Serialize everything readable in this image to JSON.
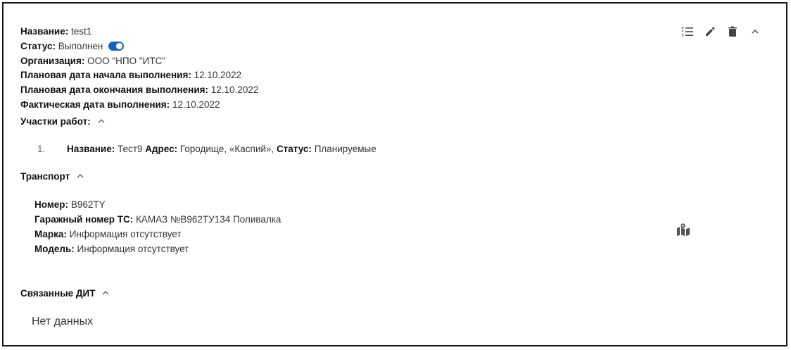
{
  "record": {
    "name_label": "Название:",
    "name_value": "test1",
    "status_label": "Статус:",
    "status_value": "Выполнен",
    "status_toggle_on": true,
    "org_label": "Организация:",
    "org_value": "ООО \"НПО \"ИТС\"",
    "plan_start_label": "Плановая дата начала выполнения:",
    "plan_start_value": "12.10.2022",
    "plan_end_label": "Плановая дата окончания выполнения:",
    "plan_end_value": "12.10.2022",
    "fact_label": "Фактическая дата выполнения:",
    "fact_value": "12.10.2022"
  },
  "toolbar": {
    "icons": [
      "list-icon",
      "edit-icon",
      "delete-icon",
      "collapse-icon"
    ]
  },
  "sections": {
    "work_areas": {
      "title": "Участки работ:",
      "items": [
        {
          "index": "1.",
          "name_label": "Название:",
          "name_value": "Тест9",
          "address_label": "Адрес:",
          "address_value": "Городище, «Каспий»,",
          "status_label": "Статус:",
          "status_value": "Планируемые"
        }
      ]
    },
    "transport": {
      "title": "Транспорт",
      "number_label": "Номер:",
      "number_value": "В962ТY",
      "garage_label": "Гаражный номер ТС:",
      "garage_value": "КАМАЗ №В962ТУ134 Поливалка",
      "brand_label": "Марка:",
      "brand_value": "Информация отсутствует",
      "model_label": "Модель:",
      "model_value": "Информация отсутствует",
      "map_icon": "map-marker-icon"
    },
    "related": {
      "title": "Связанные ДИТ",
      "empty_text": "Нет данных"
    }
  },
  "colors": {
    "accent": "#1565c0",
    "icon": "#444444"
  }
}
